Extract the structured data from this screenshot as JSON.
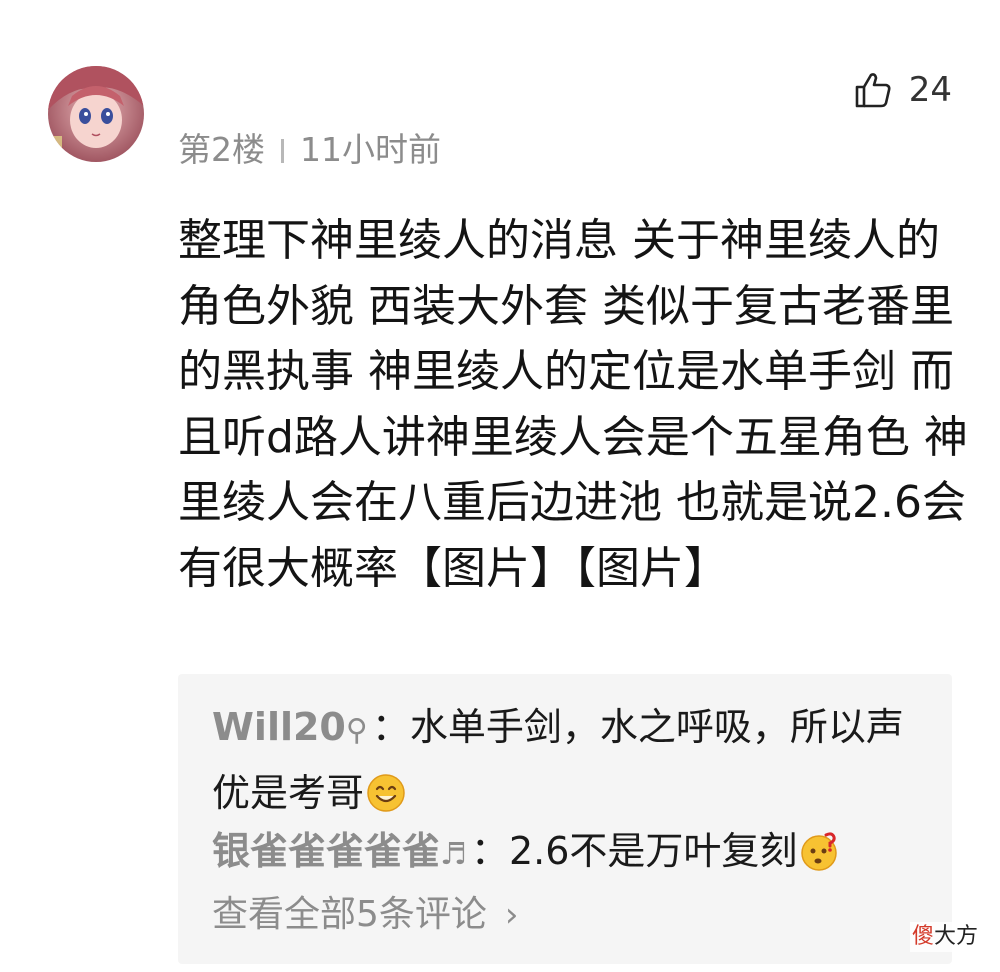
{
  "comment": {
    "floor": "第2楼",
    "time": "11小时前",
    "like_count": "24",
    "text": "整理下神里绫人的消息 关于神里绫人的角色外貌 西装大外套 类似于复古老番里的黑执事 神里绫人的定位是水单手剑 而且听d路人讲神里绫人会是个五星角色 神里绫人会在八重后边进池 也就是说2.6会有很大概率【图片】【图片】"
  },
  "replies": [
    {
      "user": "Will20",
      "badge": "⚲",
      "separator": "：",
      "text": "水单手剑，水之呼吸，所以声优是考哥",
      "emoji": "smile-emoji"
    },
    {
      "user": "银雀雀雀雀雀",
      "badge": "♬",
      "separator": "：",
      "text": "2.6不是万叶复刻",
      "emoji": "confused-emoji"
    }
  ],
  "view_all": {
    "label": "查看全部5条评论",
    "chevron": "›"
  },
  "watermark": {
    "first": "傻",
    "rest": "大方"
  },
  "colors": {
    "meta_gray": "#8c8c8c",
    "reply_bg": "#f5f5f5",
    "text_dark": "#141414",
    "emoji_yellow": "#f7c232",
    "watermark_red": "#d43a2a"
  },
  "icons": {
    "like": "thumbs-up-icon",
    "avatar": "anime-avatar",
    "chevron": "chevron-right-icon"
  }
}
